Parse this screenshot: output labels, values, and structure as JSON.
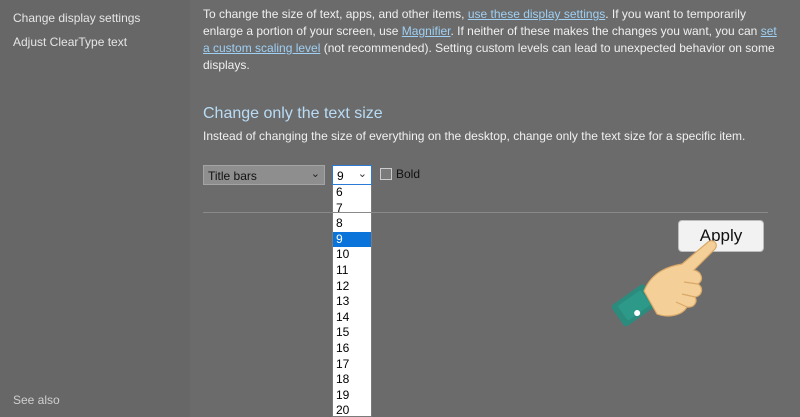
{
  "sidebar": {
    "links": [
      "Change display settings",
      "Adjust ClearType text"
    ],
    "see_also": "See also"
  },
  "intro": {
    "t1": "To change the size of text, apps, and other items, ",
    "link1": "use these display settings",
    "t2": ".  If you want to temporarily enlarge a portion of your screen, use ",
    "link2": "Magnifier",
    "t3": ".  If neither of these makes the changes you want, you can ",
    "link3": "set a custom scaling level",
    "t4": " (not recommended).  Setting custom levels can lead to unexpected behavior on some displays."
  },
  "section": {
    "title": "Change only the text size",
    "description": "Instead of changing the size of everything on the desktop, change only the text size for a specific item."
  },
  "item_select": {
    "value": "Title bars"
  },
  "size_select": {
    "value": "9",
    "options": [
      "6",
      "7",
      "8",
      "9",
      "10",
      "11",
      "12",
      "13",
      "14",
      "15",
      "16",
      "17",
      "18",
      "19",
      "20"
    ],
    "selected_index": 3
  },
  "bold": {
    "label": "Bold",
    "checked": false
  },
  "apply_label": "Apply",
  "icons": {
    "chevron": "chevron-down-icon",
    "hand": "pointing-hand-icon"
  }
}
